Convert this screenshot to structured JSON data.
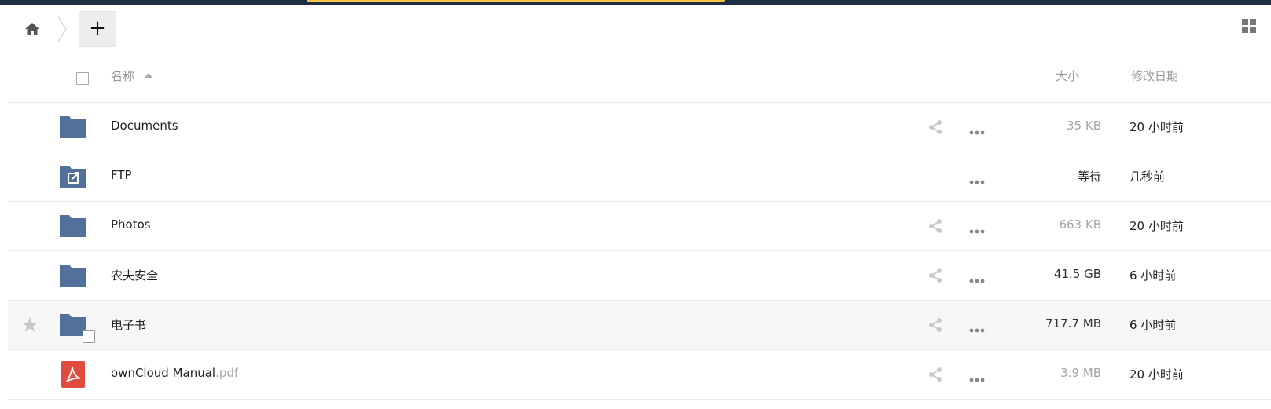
{
  "header": {
    "name_label": "名称",
    "size_label": "大小",
    "modified_label": "修改日期"
  },
  "toolbar": {
    "new_label": "+"
  },
  "colors": {
    "folder": "#51719b",
    "pdf": "#e04a3f",
    "topbar": "#1d2d44",
    "topbar_accent": "#f0c246"
  },
  "files": [
    {
      "name": "Documents",
      "ext": "",
      "type": "folder",
      "size": "35 KB",
      "size_color": "#a5a5a5",
      "modified": "20 小时前",
      "shareable": true,
      "icon": "folder-icon"
    },
    {
      "name": "FTP",
      "ext": "",
      "type": "external-folder",
      "size": "等待",
      "size_color": "#222222",
      "modified": "几秒前",
      "shareable": false,
      "icon": "external-storage-folder-icon"
    },
    {
      "name": "Photos",
      "ext": "",
      "type": "folder",
      "size": "663 KB",
      "size_color": "#a5a5a5",
      "modified": "20 小时前",
      "shareable": true,
      "icon": "folder-icon"
    },
    {
      "name": "农夫安全",
      "ext": "",
      "type": "folder",
      "size": "41.5 GB",
      "size_color": "#333333",
      "modified": "6 小时前",
      "shareable": true,
      "icon": "folder-icon"
    },
    {
      "name": "电子书",
      "ext": "",
      "type": "folder",
      "size": "717.7 MB",
      "size_color": "#333333",
      "modified": "6 小时前",
      "shareable": true,
      "icon": "folder-icon",
      "highlighted": true
    },
    {
      "name": "ownCloud Manual",
      "ext": ".pdf",
      "type": "pdf",
      "size": "3.9 MB",
      "size_color": "#a5a5a5",
      "modified": "20 小时前",
      "shareable": true,
      "icon": "pdf-icon"
    }
  ]
}
